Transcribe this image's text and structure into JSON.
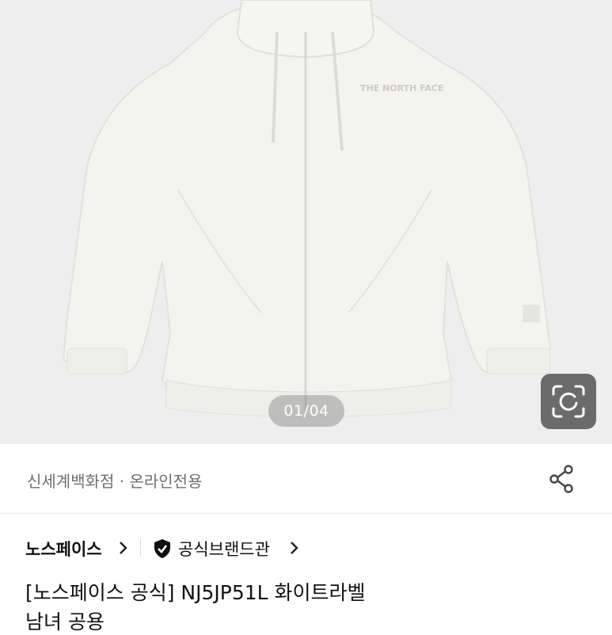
{
  "gallery": {
    "page_indicator": "01/04",
    "image_alt": "white zip-up hoodie product photo"
  },
  "store": {
    "label": "신세계백화점 · 온라인전용"
  },
  "brand": {
    "name": "노스페이스",
    "official_label": "공식브랜드관"
  },
  "product": {
    "title_line1": "[노스페이스 공식] NJ5JP51L 화이트라벨",
    "title_line2": "남녀 공용"
  },
  "colors": {
    "hero_bg": "#eeeeee",
    "hoodie": "#f4f4ef",
    "muted_text": "#6f6f6f"
  }
}
